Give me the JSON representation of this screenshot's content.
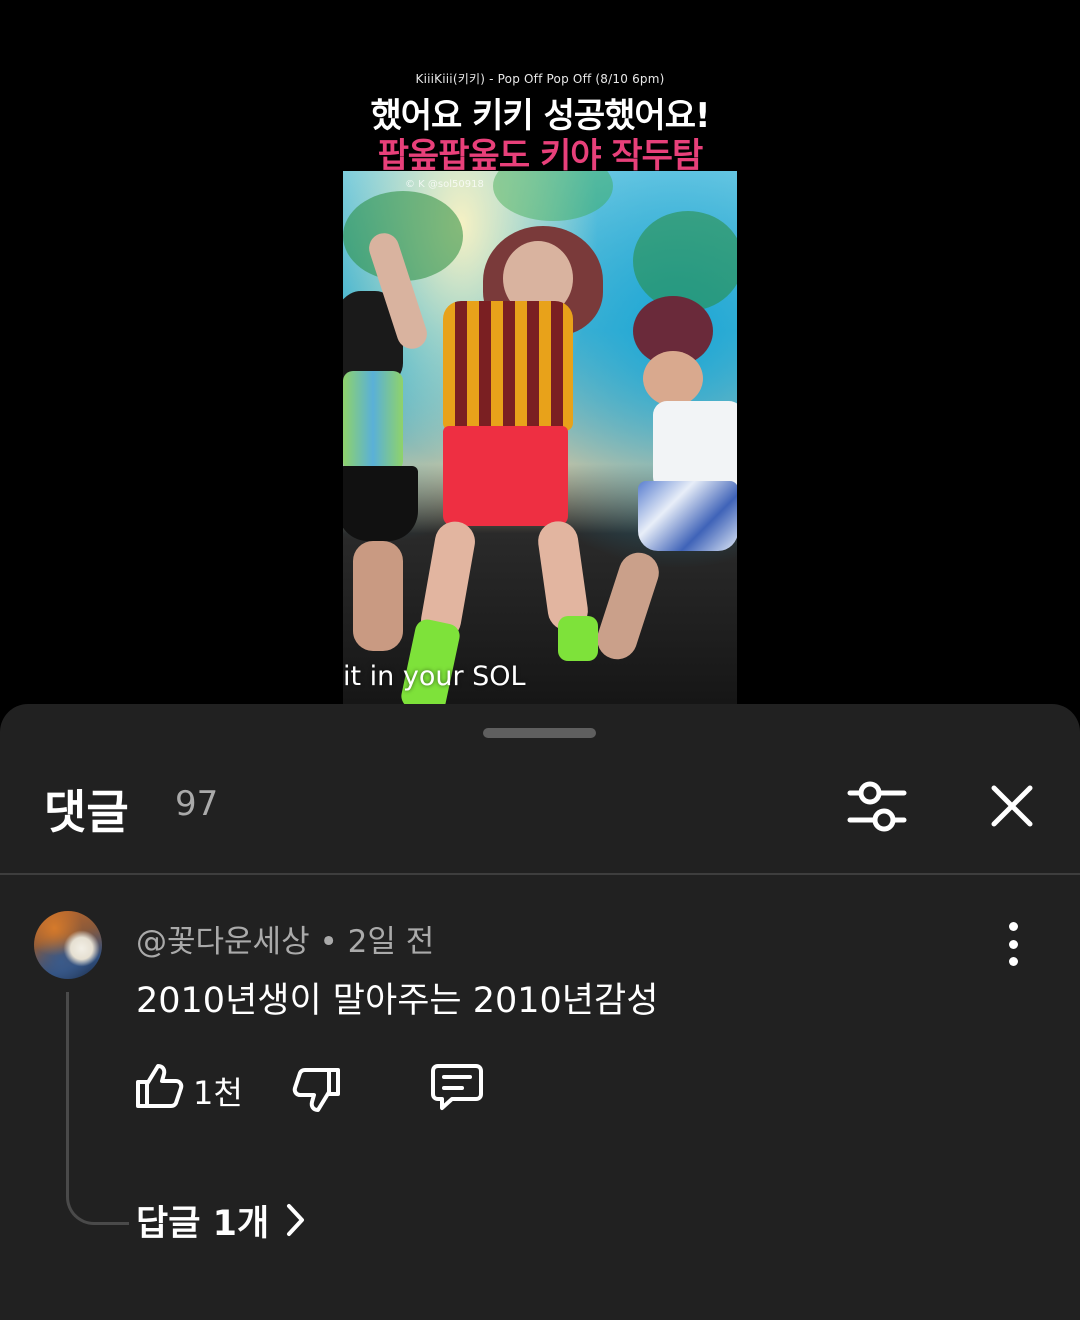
{
  "video": {
    "caption_top": "KiiiKiii(키키) - Pop Off Pop Off (8/10 6pm)",
    "title_line1": "했어요 키키 성공했어요!",
    "title_line2": "팝옾팝옾도 키야 작두탐",
    "watermark": "© K @sol50918",
    "subtitle": "it in your SOL",
    "title_line2_color": "#e8407a"
  },
  "comments_panel": {
    "title": "댓글",
    "count": "97",
    "filter_icon": "sliders-icon",
    "close_icon": "close-icon"
  },
  "comment": {
    "author": "@꽃다운세상",
    "separator": "•",
    "time": "2일 전",
    "text": "2010년생이 말아주는 2010년감성",
    "like_count": "1천",
    "replies_label": "답글 1개",
    "more_icon": "more-vertical-icon",
    "like_icon": "thumbs-up-icon",
    "dislike_icon": "thumbs-down-icon",
    "reply_icon": "comment-icon",
    "chevron_icon": "chevron-right-icon"
  }
}
